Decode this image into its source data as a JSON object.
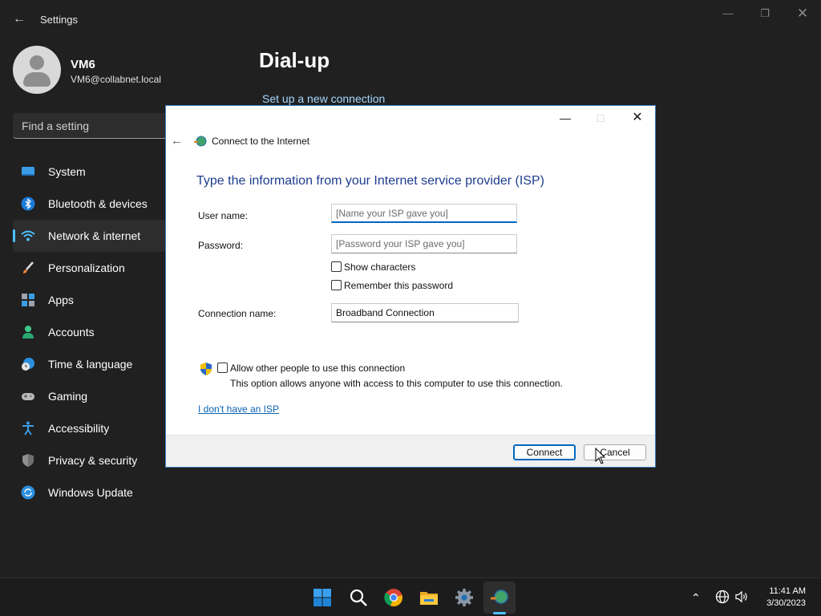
{
  "window": {
    "title": "Settings",
    "back_icon": "arrow-left-icon",
    "controls": [
      "minimize-icon",
      "maximize-icon",
      "close-icon"
    ]
  },
  "profile": {
    "name": "VM6",
    "email": "VM6@collabnet.local"
  },
  "search": {
    "placeholder": "Find a setting"
  },
  "sidebar": {
    "items": [
      {
        "label": "System",
        "icon": "monitor-icon",
        "active": false
      },
      {
        "label": "Bluetooth & devices",
        "icon": "bluetooth-icon",
        "active": false
      },
      {
        "label": "Network & internet",
        "icon": "wifi-icon",
        "active": true
      },
      {
        "label": "Personalization",
        "icon": "brush-icon",
        "active": false
      },
      {
        "label": "Apps",
        "icon": "apps-icon",
        "active": false
      },
      {
        "label": "Accounts",
        "icon": "person-icon",
        "active": false
      },
      {
        "label": "Time & language",
        "icon": "globe-clock-icon",
        "active": false
      },
      {
        "label": "Gaming",
        "icon": "gamepad-icon",
        "active": false
      },
      {
        "label": "Accessibility",
        "icon": "accessibility-icon",
        "active": false
      },
      {
        "label": "Privacy & security",
        "icon": "shield-icon",
        "active": false
      },
      {
        "label": "Windows Update",
        "icon": "update-icon",
        "active": false
      }
    ]
  },
  "main": {
    "title": "Dial-up",
    "setup_link": "Set up a new connection"
  },
  "dialog": {
    "title": "Connect to the Internet",
    "heading": "Type the information from your Internet service provider (ISP)",
    "username_label": "User name:",
    "username_placeholder": "[Name your ISP gave you]",
    "password_label": "Password:",
    "password_placeholder": "[Password your ISP gave you]",
    "show_characters": "Show characters",
    "remember_password": "Remember this password",
    "connection_name_label": "Connection name:",
    "connection_name_value": "Broadband Connection",
    "allow_others": "Allow other people to use this connection",
    "allow_note": "This option allows anyone with access to this computer to use this connection.",
    "no_isp_link": "I don't have an ISP",
    "connect_button": "Connect",
    "cancel_button": "Cancel"
  },
  "taskbar": {
    "apps": [
      "start-icon",
      "search-icon",
      "chrome-icon",
      "file-explorer-icon",
      "settings-icon",
      "network-wizard-icon"
    ],
    "time": "11:41 AM",
    "date": "3/30/2023"
  },
  "colors": {
    "accent": "#4cc2ff",
    "dialog_heading": "#1e3d8f",
    "link": "#0b63b6"
  }
}
